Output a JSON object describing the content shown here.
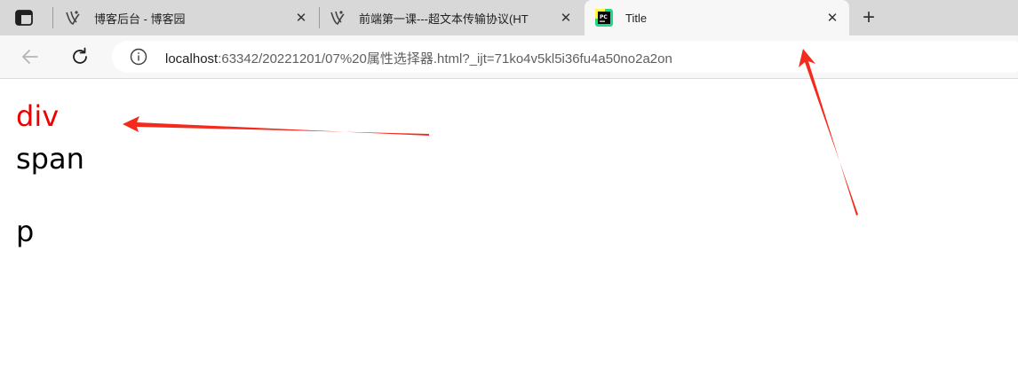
{
  "browser": {
    "tabs": [
      {
        "title": "博客后台 - 博客园",
        "icon": "cnblogs-icon",
        "active": false
      },
      {
        "title": "前端第一课---超文本传输协议(HT",
        "icon": "cnblogs-icon",
        "active": false
      },
      {
        "title": "Title",
        "icon": "pycharm-icon",
        "active": true
      }
    ],
    "new_tab_label": "+",
    "address": {
      "host": "localhost",
      "rest": ":63342/20221201/07%20属性选择器.html?_ijt=71ko4v5kl5i36fu4a50no2a2on"
    }
  },
  "page": {
    "div_text": "div",
    "span_text": "span",
    "p_text": "p"
  },
  "colors": {
    "accent_red": "#ee0000",
    "arrow_red": "#f42b1c"
  }
}
